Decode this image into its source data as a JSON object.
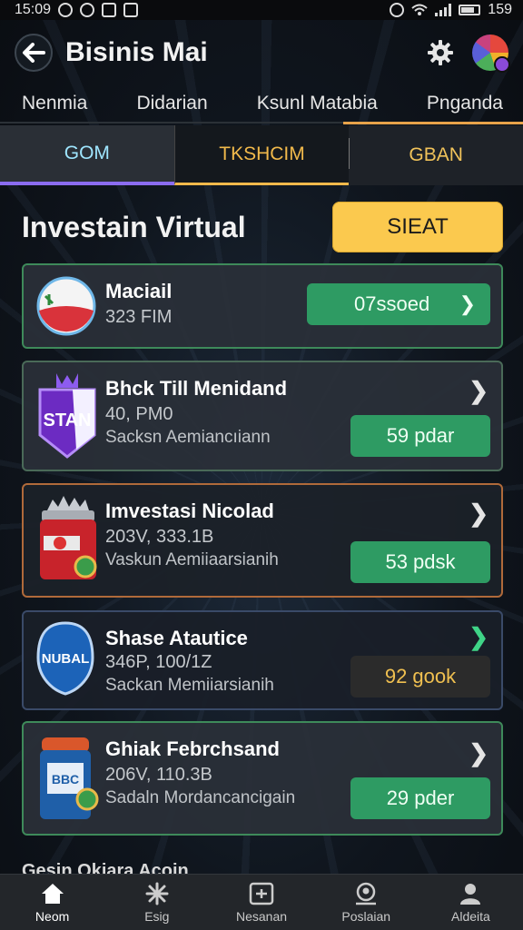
{
  "status_bar": {
    "time": "15:09",
    "battery": "159"
  },
  "header": {
    "title": "Bisinis Mai"
  },
  "nav": [
    "Nenmia",
    "Didarian",
    "Ksunl Matabia",
    "Pnganda"
  ],
  "tabs": [
    "GOM",
    "TKSHCIM",
    "GBAN"
  ],
  "section": {
    "title": "Investain Virtual",
    "button": "SIEAT"
  },
  "cards": [
    {
      "name": "Maciail",
      "sub": "323 FIM",
      "desc": "",
      "pill": "07ssoed"
    },
    {
      "name": "Bhck Till Menidand",
      "sub": "40, PM0",
      "desc": "Sacksn Aemiancıiann",
      "pill": "59 pdar",
      "logo_text": "STAN"
    },
    {
      "name": "Imvestasi Nicolad",
      "sub": "203V, 333.1B",
      "desc": "Vaskun Aemiiaarsianih",
      "pill": "53 pdsk"
    },
    {
      "name": "Shase Atautice",
      "sub": "346P, 100/1Z",
      "desc": "Sackan Memiiarsianih",
      "pill": "92 gook",
      "logo_text": "NUBAL"
    },
    {
      "name": "Ghiak Febrchsand",
      "sub": "206V, 110.3B",
      "desc": "Sadaln Mordancancigain",
      "pill": "29 pder",
      "logo_text": "BBC"
    }
  ],
  "peek": "Gesin Okiara Acoin",
  "bottom_nav": [
    "Neom",
    "Esig",
    "Nesanan",
    "Poslaian",
    "Aldeita"
  ],
  "colors": {
    "accent_green": "#2e9b63",
    "accent_yellow": "#fbc94e",
    "accent_orange": "#e8a34a"
  }
}
